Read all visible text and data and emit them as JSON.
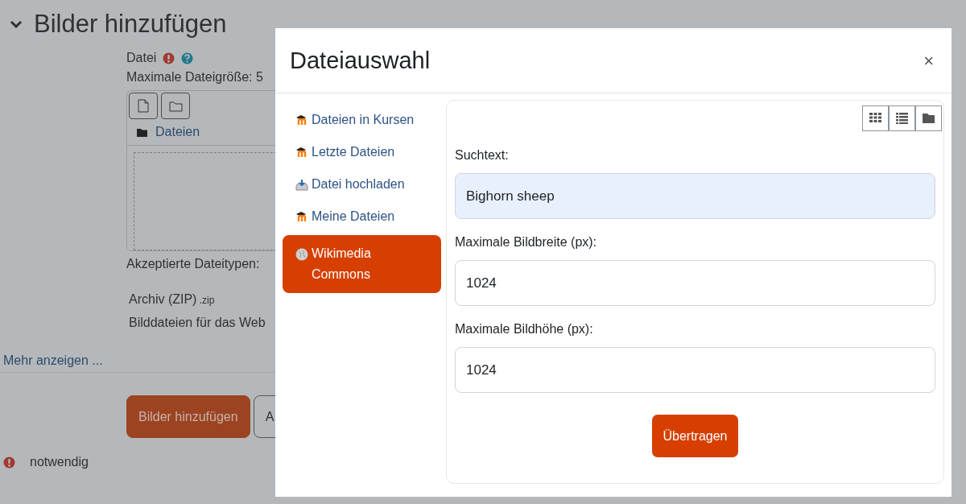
{
  "page": {
    "section": {
      "title": "Bilder hinzufügen",
      "expanded": true
    },
    "file_label": "Datei",
    "max_size": "Maximale Dateigröße: 5",
    "folder_path": "Dateien",
    "accepted_label": "Akzeptierte Dateitypen:",
    "file_types": [
      {
        "name": "Archiv (ZIP)",
        "ext": ".zip"
      },
      {
        "name": "Bilddateien für das Web"
      }
    ],
    "more_link": "Mehr anzeigen ...",
    "buttons": [
      {
        "label": "Bilder hinzufügen",
        "kind": "primary"
      },
      {
        "label": "A",
        "kind": "secondary"
      }
    ],
    "required_note": "notwendig"
  },
  "dialog": {
    "title": "Dateiauswahl",
    "close": "×",
    "repositories": [
      {
        "label": "Dateien in Kursen",
        "kind": "moodle",
        "selected": false
      },
      {
        "label": "Letzte Dateien",
        "kind": "moodle",
        "selected": false
      },
      {
        "label": "Datei hochladen",
        "kind": "upload",
        "selected": false
      },
      {
        "label": "Meine Dateien",
        "kind": "moodle",
        "selected": false
      },
      {
        "label": "Wikimedia Commons",
        "kind": "globe",
        "selected": true
      }
    ],
    "views": [
      {
        "kind": "icons"
      },
      {
        "kind": "list"
      },
      {
        "kind": "tree"
      }
    ],
    "fields": [
      {
        "label": "Suchtext:",
        "value": "Bighorn sheep",
        "autofilled": true
      },
      {
        "label": "Maximale Bildbreite (px):",
        "value": "1024",
        "autofilled": false
      },
      {
        "label": "Maximale Bildhöhe (px):",
        "value": "1024",
        "autofilled": false
      }
    ],
    "submit": "Übertragen"
  }
}
